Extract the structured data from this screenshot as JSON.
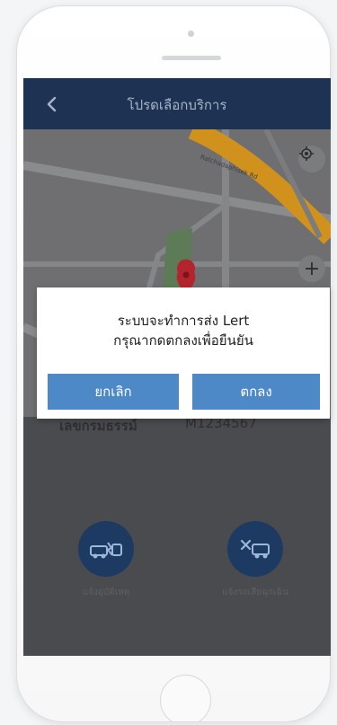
{
  "header": {
    "title": "โปรดเลือกบริการ",
    "back_icon": "chevron-left-icon"
  },
  "map": {
    "street_label": "Ratchadaphisek Rd",
    "locate_icon": "crosshair-icon",
    "zoom_in_label": "+",
    "colors": {
      "road_major": "#d0921c",
      "park": "#5d7b56"
    }
  },
  "info": {
    "label": "เลขกรมธรรม์",
    "value": "M1234567"
  },
  "services": [
    {
      "label": "แจ้งอุบัติเหตุ",
      "icon": "car-crash-icon"
    },
    {
      "label": "แจ้งรถเสียฉุกเฉิน",
      "icon": "car-repair-icon"
    }
  ],
  "dialog": {
    "line1": "ระบบจะทำการส่ง Lert",
    "line2": "กรุณากดตกลงเพื่อยืนยัน",
    "cancel_label": "ยกเลิก",
    "ok_label": "ตกลง",
    "button_color": "#4e89c7"
  },
  "colors": {
    "nav_bar": "#1e3354",
    "accent": "#1c3a62",
    "overlay_bg": "#4a4b4e"
  }
}
